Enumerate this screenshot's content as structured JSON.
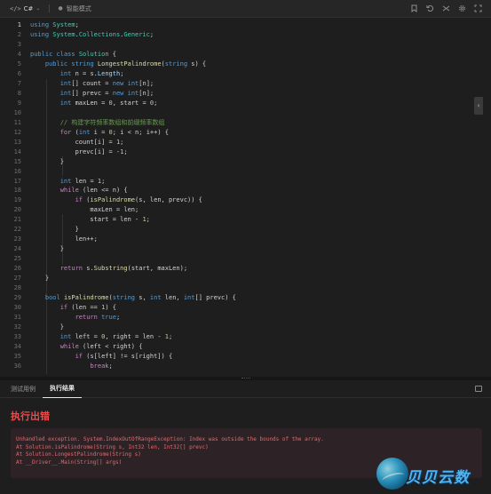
{
  "toolbar": {
    "language": "C#",
    "mode_label": "智能模式",
    "icons": [
      "bookmark-icon",
      "reset-icon",
      "shuffle-icon",
      "settings-icon",
      "fullscreen-icon"
    ]
  },
  "editor": {
    "active_line": 1,
    "lines": [
      {
        "n": "1",
        "html": "<span class=\"kw\">using</span> <span class=\"ty\">System</span>;"
      },
      {
        "n": "2",
        "html": "<span class=\"kw\">using</span> <span class=\"ty\">System</span>.<span class=\"ty\">Collections</span>.<span class=\"ty\">Generic</span>;"
      },
      {
        "n": "3",
        "html": ""
      },
      {
        "n": "4",
        "html": "<span class=\"kw\">public</span> <span class=\"kw\">class</span> <span class=\"ty\">Solution</span> {"
      },
      {
        "n": "5",
        "html": "    <span class=\"kw\">public</span> <span class=\"kw\">string</span> <span class=\"fn\">LongestPalindrome</span>(<span class=\"kw\">string</span> s) {"
      },
      {
        "n": "6",
        "html": "        <span class=\"kw\">int</span> n = s.<span class=\"id\">Length</span>;"
      },
      {
        "n": "7",
        "html": "        <span class=\"kw\">int</span>[] count = <span class=\"kw\">new</span> <span class=\"kw\">int</span>[n];"
      },
      {
        "n": "8",
        "html": "        <span class=\"kw\">int</span>[] prevc = <span class=\"kw\">new</span> <span class=\"kw\">int</span>[n];"
      },
      {
        "n": "9",
        "html": "        <span class=\"kw\">int</span> maxLen = <span class=\"nm\">0</span>, start = <span class=\"nm\">0</span>;"
      },
      {
        "n": "10",
        "html": ""
      },
      {
        "n": "11",
        "html": "        <span class=\"cm\">// 构建字符频率数组和前缀频率数组</span>"
      },
      {
        "n": "12",
        "html": "        <span class=\"ctl\">for</span> (<span class=\"kw\">int</span> i = <span class=\"nm\">0</span>; i &lt; n; i++) {"
      },
      {
        "n": "13",
        "html": "            count[i] = <span class=\"nm\">1</span>;"
      },
      {
        "n": "14",
        "html": "            prevc[i] = -<span class=\"nm\">1</span>;"
      },
      {
        "n": "15",
        "html": "        }"
      },
      {
        "n": "16",
        "html": ""
      },
      {
        "n": "17",
        "html": "        <span class=\"kw\">int</span> len = <span class=\"nm\">1</span>;"
      },
      {
        "n": "18",
        "html": "        <span class=\"ctl\">while</span> (len &lt;= n) {"
      },
      {
        "n": "19",
        "html": "            <span class=\"ctl\">if</span> (<span class=\"fn\">isPalindrome</span>(s, len, prevc)) {"
      },
      {
        "n": "20",
        "html": "                maxLen = len;"
      },
      {
        "n": "21",
        "html": "                start = len - <span class=\"nm\">1</span>;"
      },
      {
        "n": "22",
        "html": "            }"
      },
      {
        "n": "23",
        "html": "            len++;"
      },
      {
        "n": "24",
        "html": "        }"
      },
      {
        "n": "25",
        "html": ""
      },
      {
        "n": "26",
        "html": "        <span class=\"ctl\">return</span> s.<span class=\"fn\">Substring</span>(start, maxLen);"
      },
      {
        "n": "27",
        "html": "    }"
      },
      {
        "n": "28",
        "html": ""
      },
      {
        "n": "29",
        "html": "    <span class=\"kw\">bool</span> <span class=\"fn\">isPalindrome</span>(<span class=\"kw\">string</span> s, <span class=\"kw\">int</span> len, <span class=\"kw\">int</span>[] prevc) {"
      },
      {
        "n": "30",
        "html": "        <span class=\"ctl\">if</span> (len == <span class=\"nm\">1</span>) {"
      },
      {
        "n": "31",
        "html": "            <span class=\"ctl\">return</span> <span class=\"kw\">true</span>;"
      },
      {
        "n": "32",
        "html": "        }"
      },
      {
        "n": "33",
        "html": "        <span class=\"kw\">int</span> left = <span class=\"nm\">0</span>, right = len - <span class=\"nm\">1</span>;"
      },
      {
        "n": "34",
        "html": "        <span class=\"ctl\">while</span> (left &lt; right) {"
      },
      {
        "n": "35",
        "html": "            <span class=\"ctl\">if</span> (s[left] != s[right]) {"
      },
      {
        "n": "36",
        "html": "                <span class=\"ctl\">break</span>;"
      }
    ]
  },
  "panel": {
    "tabs": [
      {
        "label": "测试用例",
        "active": false
      },
      {
        "label": "执行结果",
        "active": true
      }
    ],
    "error_title": "执行出错",
    "error_lines": [
      "Unhandled exception. System.IndexOutOfRangeException: Index was outside the bounds of the array.",
      "At Solution.isPalindrome(String s, Int32 len, Int32[] prevc)",
      "At Solution.LongestPalindrome(String s)",
      "At __Driver__.Main(String[] args)"
    ]
  },
  "watermark": {
    "text": "贝贝云数"
  }
}
